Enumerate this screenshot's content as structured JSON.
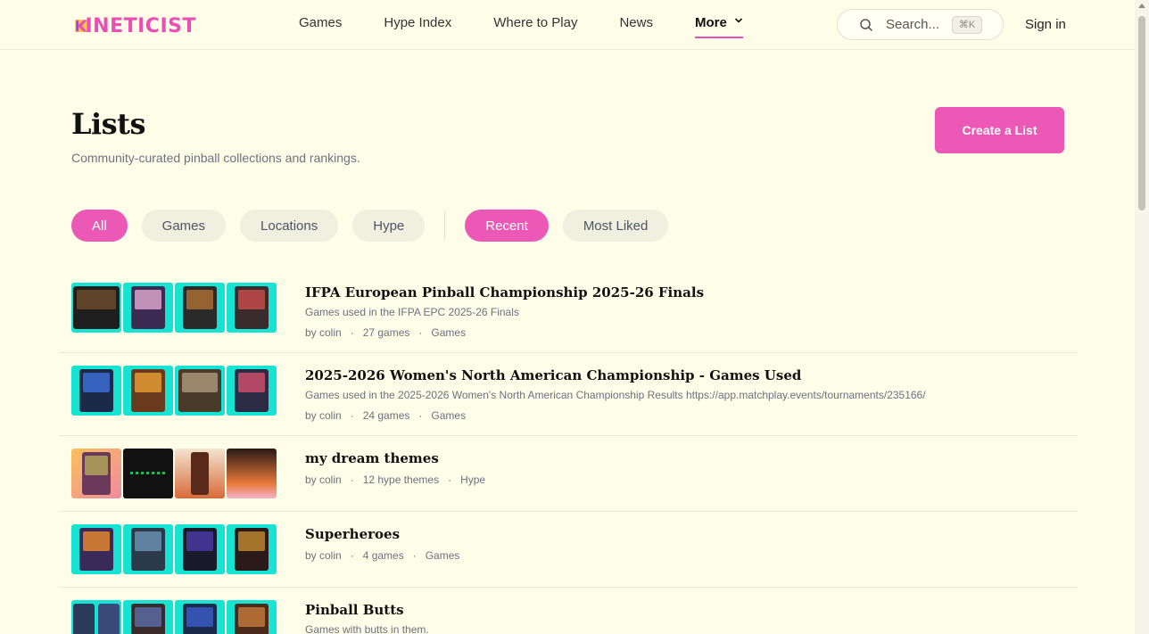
{
  "brand": {
    "name": "INETICIST",
    "accent": "#ec58b6"
  },
  "nav": {
    "items": [
      {
        "label": "Games"
      },
      {
        "label": "Hype Index"
      },
      {
        "label": "Where to Play"
      },
      {
        "label": "News"
      },
      {
        "label": "More"
      }
    ]
  },
  "search": {
    "placeholder": "Search...",
    "shortcut": "⌘K"
  },
  "header": {
    "signin": "Sign in"
  },
  "hero": {
    "title": "Lists",
    "subtitle": "Community-curated pinball collections and rankings.",
    "create_label": "Create a List"
  },
  "filters": {
    "types": [
      "All",
      "Games",
      "Locations",
      "Hype"
    ],
    "sorts": [
      "Recent",
      "Most Liked"
    ]
  },
  "lists": [
    {
      "title": "IFPA European Pinball Championship 2025-26 Finals",
      "description": "Games used in the IFPA EPC 2025-26 Finals",
      "author": "by colin",
      "count": "27 games",
      "kind": "Games"
    },
    {
      "title": "2025-2026 Women's North American Championship - Games Used",
      "description": "Games used in the 2025-2026 Women's North American Championship Results https://app.matchplay.events/tournaments/235166/",
      "author": "by colin",
      "count": "24 games",
      "kind": "Games"
    },
    {
      "title": "my dream themes",
      "description": "",
      "author": "by colin",
      "count": "12 hype themes",
      "kind": "Hype"
    },
    {
      "title": "Superheroes",
      "description": "",
      "author": "by colin",
      "count": "4 games",
      "kind": "Games"
    },
    {
      "title": "Pinball Butts",
      "description": "Games with butts in them.",
      "author": "",
      "count": "",
      "kind": ""
    }
  ]
}
